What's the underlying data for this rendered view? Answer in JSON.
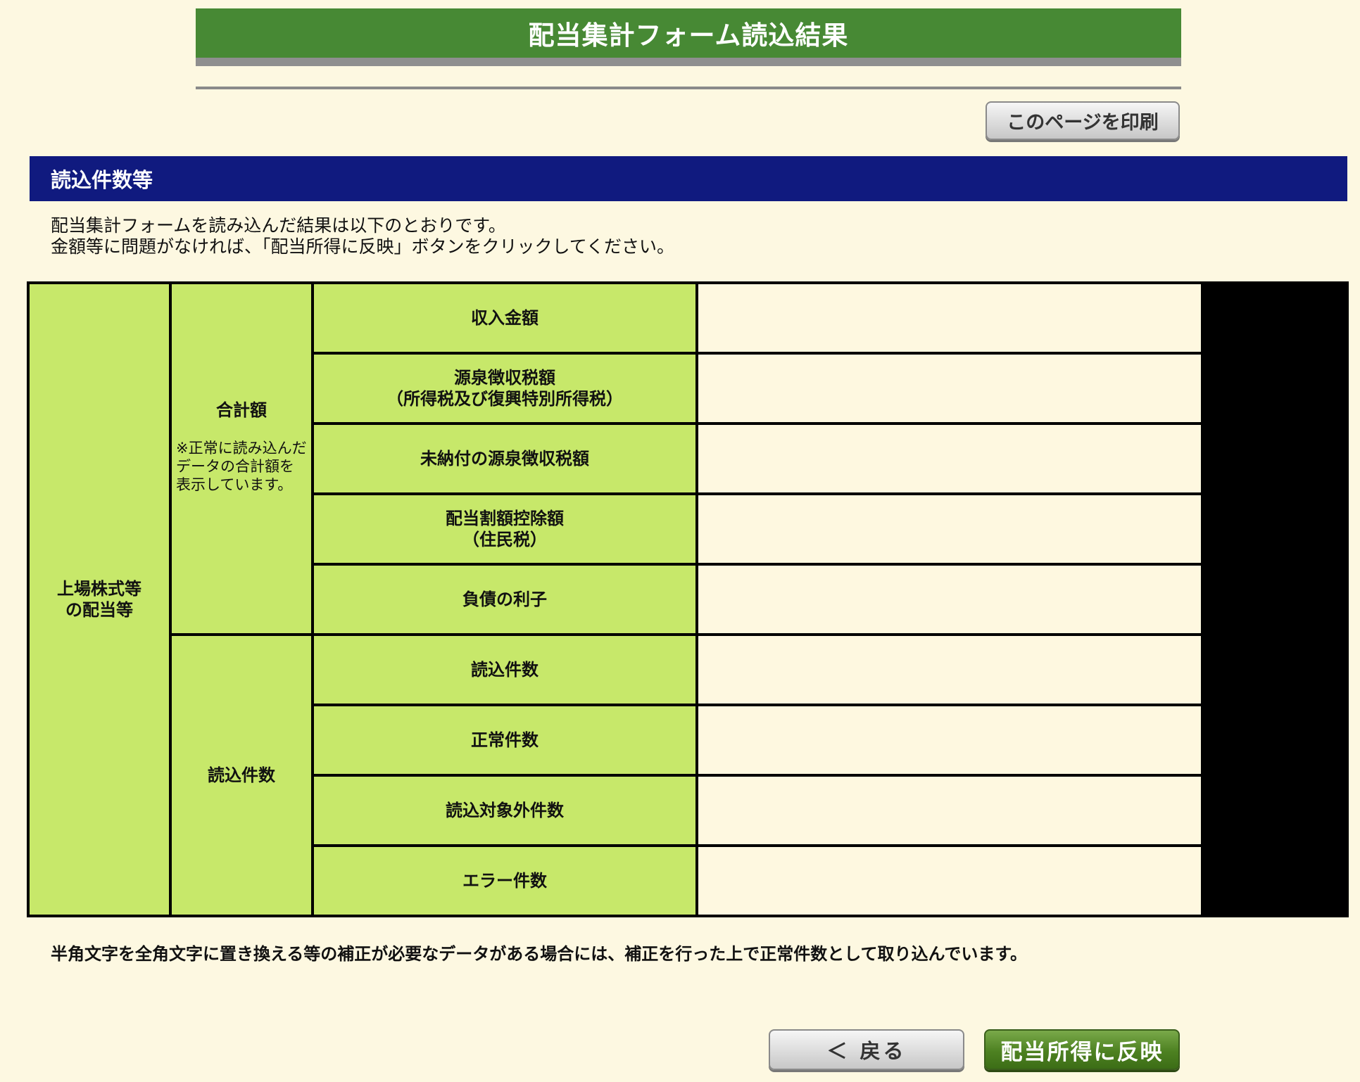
{
  "title": "配当集計フォーム読込結果",
  "print_button": "このページを印刷",
  "section_header": "読込件数等",
  "intro": {
    "line1": "配当集計フォームを読み込んだ結果は以下のとおりです。",
    "line2": "金額等に問題がなければ、「配当所得に反映」ボタンをクリックしてください。"
  },
  "table": {
    "category": "上場株式等\nの配当等",
    "total_group": {
      "label": "合計額",
      "note": "※正常に読み込んだデータの合計額を表示しています。"
    },
    "count_group": {
      "label": "読込件数"
    },
    "rows": [
      {
        "label": "収入金額",
        "value": ""
      },
      {
        "label": "源泉徴収税額\n（所得税及び復興特別所得税）",
        "value": ""
      },
      {
        "label": "未納付の源泉徴収税額",
        "value": ""
      },
      {
        "label": "配当割額控除額\n（住民税）",
        "value": ""
      },
      {
        "label": "負債の利子",
        "value": ""
      },
      {
        "label": "読込件数",
        "value": ""
      },
      {
        "label": "正常件数",
        "value": ""
      },
      {
        "label": "読込対象外件数",
        "value": ""
      },
      {
        "label": "エラー件数",
        "value": ""
      }
    ]
  },
  "footer_note": "半角文字を全角文字に置き換える等の補正が必要なデータがある場合には、補正を行った上で正常件数として取り込んでいます。",
  "back_button": "＜ 戻る",
  "apply_button": "配当所得に反映"
}
